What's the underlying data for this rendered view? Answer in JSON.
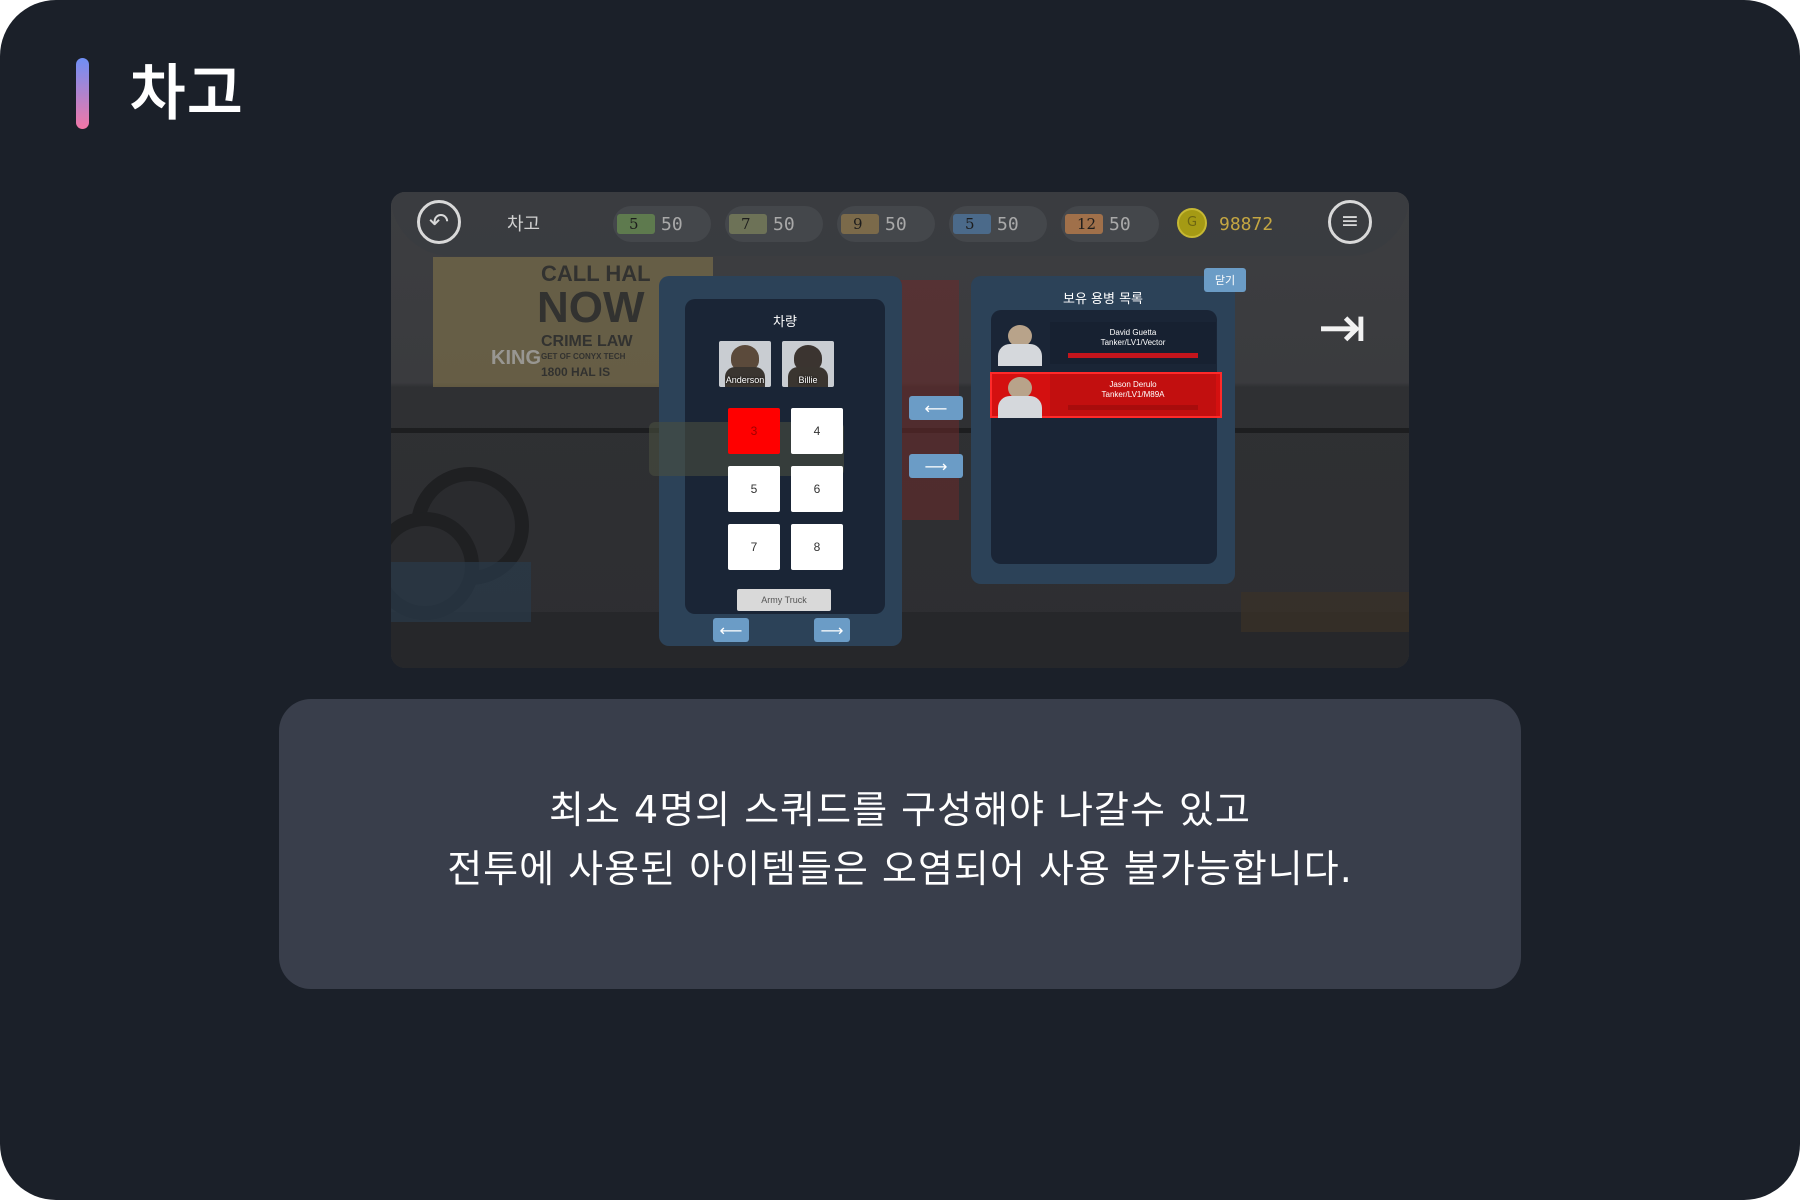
{
  "page": {
    "title": "차고"
  },
  "game": {
    "screen_title": "차고",
    "resources": [
      {
        "badge": "5",
        "value": "50",
        "color": "#5e7a4e"
      },
      {
        "badge": "7",
        "value": "50",
        "color": "#6d7257"
      },
      {
        "badge": "9",
        "value": "50",
        "color": "#7b6a4a"
      },
      {
        "badge": "5",
        "value": "50",
        "color": "#4b6a8a"
      },
      {
        "badge": "12",
        "value": "50",
        "color": "#a0704a"
      }
    ],
    "gold": {
      "icon": "G",
      "value": "98872"
    },
    "poster": {
      "line1": "CALL HAL",
      "line2": "NOW",
      "line3": "CRIME LAW",
      "line4": "GET OF CONYX TECH",
      "line5": "1800 HAL IS",
      "logo": "KING"
    },
    "vehicle_panel": {
      "title": "차량",
      "crew": [
        {
          "name": "Anderson"
        },
        {
          "name": "Billie"
        }
      ],
      "slots": [
        {
          "label": "3",
          "selected": true
        },
        {
          "label": "4"
        },
        {
          "label": "5"
        },
        {
          "label": "6"
        },
        {
          "label": "7"
        },
        {
          "label": "8"
        }
      ],
      "vehicle_name": "Army Truck",
      "prev": "⟵",
      "next": "⟶"
    },
    "transfer": {
      "to_vehicle": "⟵",
      "to_list": "⟶"
    },
    "mercenary_panel": {
      "title": "보유 용병 목록",
      "close": "닫기",
      "items": [
        {
          "name": "David Guetta",
          "detail": "Tanker/LV1/Vector",
          "selected": false
        },
        {
          "name": "Jason Derulo",
          "detail": "Tanker/LV1/M89A",
          "selected": true
        }
      ]
    }
  },
  "description": {
    "line1": "최소 4명의 스쿼드를 구성해야 나갈수 있고",
    "line2": "전투에 사용된 아이템들은 오염되어 사용 불가능합니다."
  }
}
